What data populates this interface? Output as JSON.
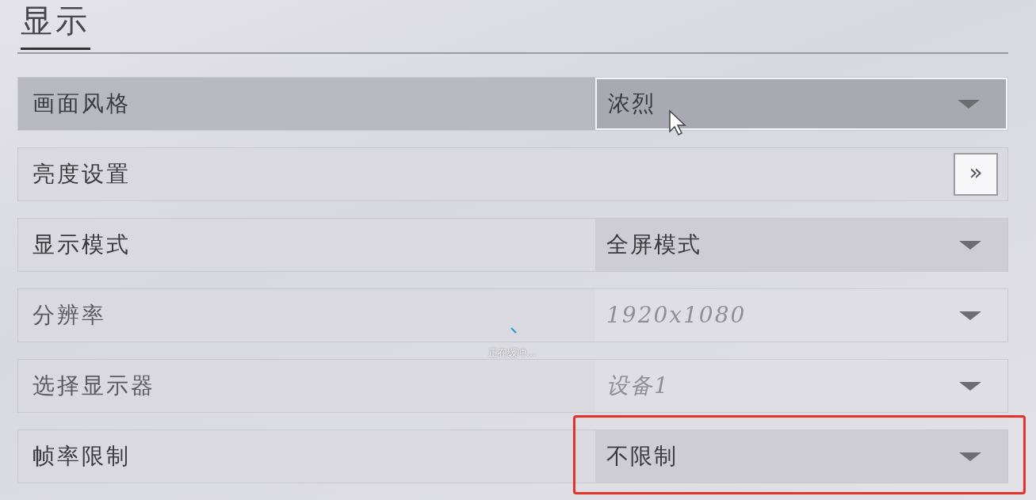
{
  "section": {
    "title": "显示"
  },
  "rows": [
    {
      "kind": "dropdown",
      "label": "画面风格",
      "value": "浓烈",
      "selected": true,
      "disabled": false,
      "highlighted": false
    },
    {
      "kind": "button",
      "label": "亮度设置",
      "button": "»",
      "selected": false,
      "disabled": false,
      "highlighted": false
    },
    {
      "kind": "dropdown",
      "label": "显示模式",
      "value": "全屏模式",
      "selected": false,
      "disabled": false,
      "highlighted": false
    },
    {
      "kind": "dropdown",
      "label": "分辨率",
      "value": "1920x1080",
      "selected": false,
      "disabled": true,
      "highlighted": false
    },
    {
      "kind": "dropdown",
      "label": "选择显示器",
      "value": "设备1",
      "selected": false,
      "disabled": true,
      "highlighted": false
    },
    {
      "kind": "dropdown",
      "label": "帧率限制",
      "value": "不限制",
      "selected": false,
      "disabled": false,
      "highlighted": true
    }
  ],
  "overlay": {
    "text": "正在缓冲..."
  }
}
